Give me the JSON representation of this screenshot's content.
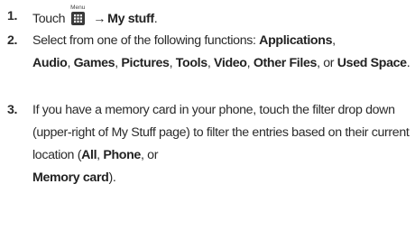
{
  "step1": {
    "number": "1.",
    "text_before": "Touch",
    "menu_key_label": "Menu",
    "menu_key_icon": "menu-grid-icon",
    "arrow": "→",
    "target": "My stuff",
    "end": "."
  },
  "step2": {
    "number": "2.",
    "intro": "Select from one of the following functions: ",
    "items": [
      "Applications",
      "Audio",
      "Games",
      "Pictures",
      "Tools",
      "Video",
      "Other Files",
      "Used Space"
    ],
    "sep": ", ",
    "or": ", or ",
    "end": "."
  },
  "step3": {
    "number": "3.",
    "text": "If you have a memory card in your phone, touch the filter drop down (upper-right of My Stuff page) to filter the entries based on their current location (",
    "opt1": "All",
    "sep1": ", ",
    "opt2": "Phone",
    "sep2": ", or",
    "opt3": "Memory card",
    "end": ")."
  }
}
